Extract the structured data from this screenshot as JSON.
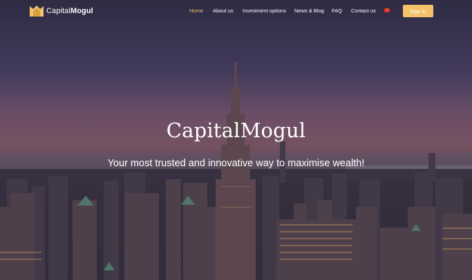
{
  "brand": {
    "name_light": "Capital",
    "name_bold": "Mogul"
  },
  "nav": {
    "items": [
      "Home",
      "About us",
      "Investment options",
      "News & Blog",
      "FAQ",
      "Contact us"
    ],
    "active": "Home",
    "language_flag": "flag-icon",
    "signin_label": "Sign in"
  },
  "hero": {
    "title": "CapitalMogul",
    "subtitle": "Your most trusted and innovative way to maximise wealth!"
  },
  "colors": {
    "accent": "#f3c26b",
    "active_link": "#f0c36b"
  }
}
